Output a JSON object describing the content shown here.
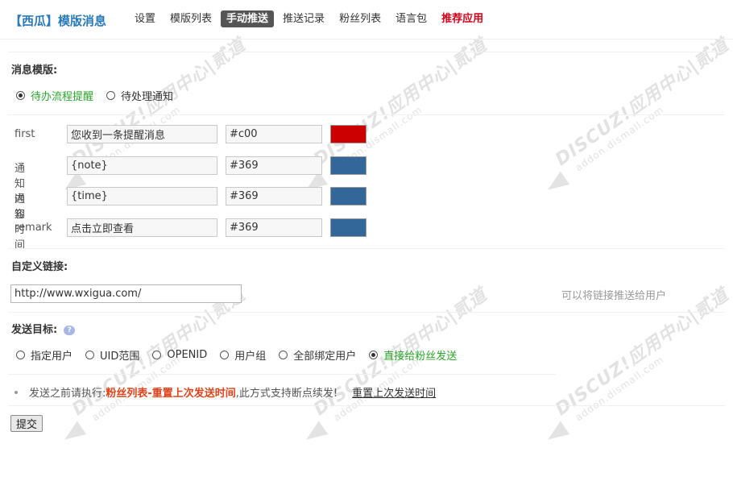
{
  "header": {
    "brand": "【西瓜】模版消息",
    "nav": [
      {
        "label": "设置"
      },
      {
        "label": "模版列表"
      },
      {
        "label": "手动推送"
      },
      {
        "label": "推送记录"
      },
      {
        "label": "粉丝列表"
      },
      {
        "label": "语言包"
      },
      {
        "label": "推荐应用"
      }
    ]
  },
  "template_section": {
    "title": "消息模版:",
    "options": [
      {
        "label": "待办流程提醒",
        "selected": true
      },
      {
        "label": "待处理通知",
        "selected": false
      }
    ]
  },
  "fields": [
    {
      "label": "first",
      "value": "您收到一条提醒消息",
      "color": "#c00",
      "swatch": "#cc0000"
    },
    {
      "label": "通知内容",
      "value": "{note}",
      "color": "#369",
      "swatch": "#336699"
    },
    {
      "label": "通知时间",
      "value": "{time}",
      "color": "#369",
      "swatch": "#336699"
    },
    {
      "label": "remark",
      "value": "点击立即查看",
      "color": "#369",
      "swatch": "#336699"
    }
  ],
  "link_section": {
    "title": "自定义链接:",
    "url": "http://www.wxigua.com/",
    "hint": "可以将链接推送给用户"
  },
  "target_section": {
    "title": "发送目标:",
    "help_icon": "question-icon",
    "options": [
      {
        "label": "指定用户",
        "selected": false
      },
      {
        "label": "UID范围",
        "selected": false
      },
      {
        "label": "OPENID",
        "selected": false
      },
      {
        "label": "用户组",
        "selected": false
      },
      {
        "label": "全部绑定用户",
        "selected": false
      },
      {
        "label": "直接给粉丝发送",
        "selected": true
      }
    ]
  },
  "note": {
    "prefix": "发送之前请执行:",
    "highlight": "粉丝列表-重置上次发送时间",
    "suffix": ",此方式支持断点续发!",
    "link": "重置上次发送时间"
  },
  "submit_label": "提交",
  "watermark": {
    "brand": "DISCUZ!应用中心|贰道",
    "domain": "addon.dismall.com"
  }
}
